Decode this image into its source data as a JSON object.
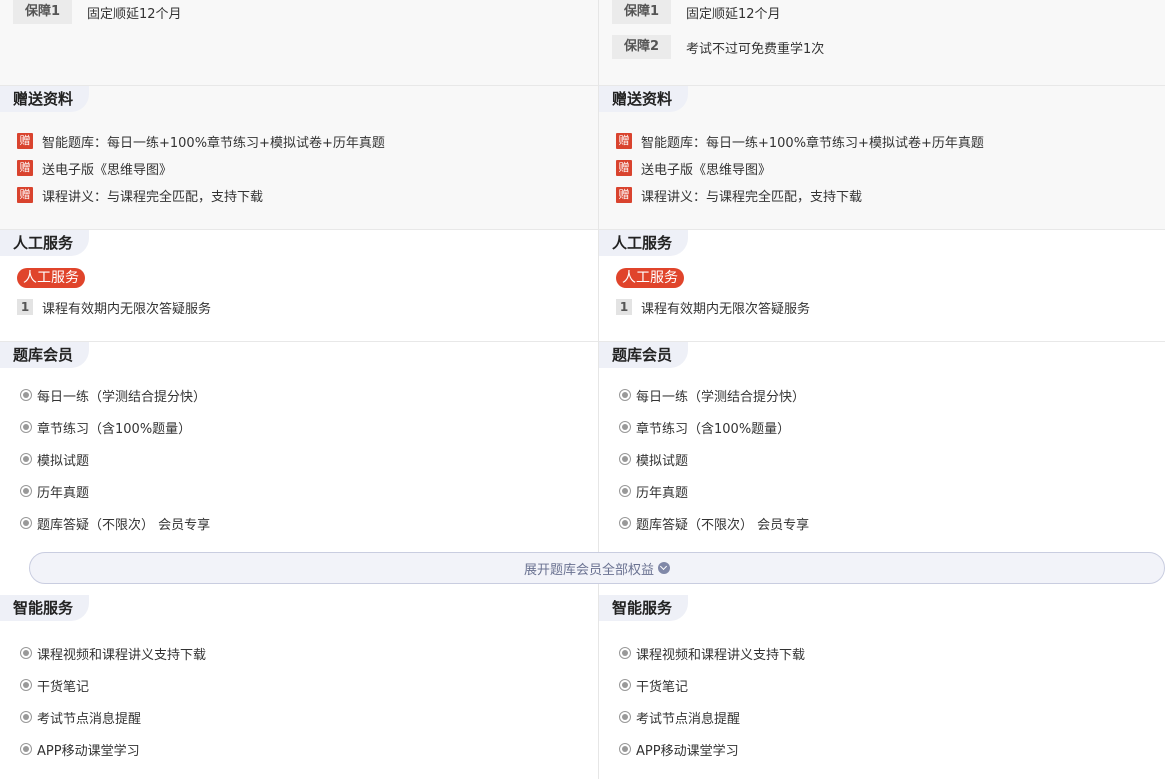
{
  "columns": [
    {
      "guarantees": [
        {
          "tag": "保障1",
          "text": "固定顺延12个月"
        }
      ],
      "gift": {
        "title": "赠送资料",
        "tag": "赠",
        "items": [
          "智能题库：每日一练+100%章节练习+模拟试卷+历年真题",
          "送电子版《思维导图》",
          "课程讲义：与课程完全匹配，支持下载"
        ]
      },
      "manual": {
        "title": "人工服务",
        "badge": "人工服务",
        "items": [
          {
            "num": "1",
            "text": "课程有效期内无限次答疑服务"
          }
        ]
      },
      "member": {
        "title": "题库会员",
        "items": [
          "每日一练（学测结合提分快）",
          "章节练习（含100%题量）",
          "模拟试题",
          "历年真题",
          "题库答疑（不限次） 会员专享"
        ]
      },
      "smart": {
        "title": "智能服务",
        "items": [
          "课程视频和课程讲义支持下载",
          "干货笔记",
          "考试节点消息提醒",
          "APP移动课堂学习"
        ]
      }
    },
    {
      "guarantees": [
        {
          "tag": "保障1",
          "text": "固定顺延12个月"
        },
        {
          "tag": "保障2",
          "text": "考试不过可免费重学1次"
        }
      ],
      "gift": {
        "title": "赠送资料",
        "tag": "赠",
        "items": [
          "智能题库：每日一练+100%章节练习+模拟试卷+历年真题",
          "送电子版《思维导图》",
          "课程讲义：与课程完全匹配，支持下载"
        ]
      },
      "manual": {
        "title": "人工服务",
        "badge": "人工服务",
        "items": [
          {
            "num": "1",
            "text": "课程有效期内无限次答疑服务"
          }
        ]
      },
      "member": {
        "title": "题库会员",
        "items": [
          "每日一练（学测结合提分快）",
          "章节练习（含100%题量）",
          "模拟试题",
          "历年真题",
          "题库答疑（不限次） 会员专享"
        ]
      },
      "smart": {
        "title": "智能服务",
        "items": [
          "课程视频和课程讲义支持下载",
          "干货笔记",
          "考试节点消息提醒",
          "APP移动课堂学习"
        ]
      }
    }
  ],
  "expand": {
    "label": "展开题库会员全部权益",
    "icon": "chevron-down-icon"
  }
}
